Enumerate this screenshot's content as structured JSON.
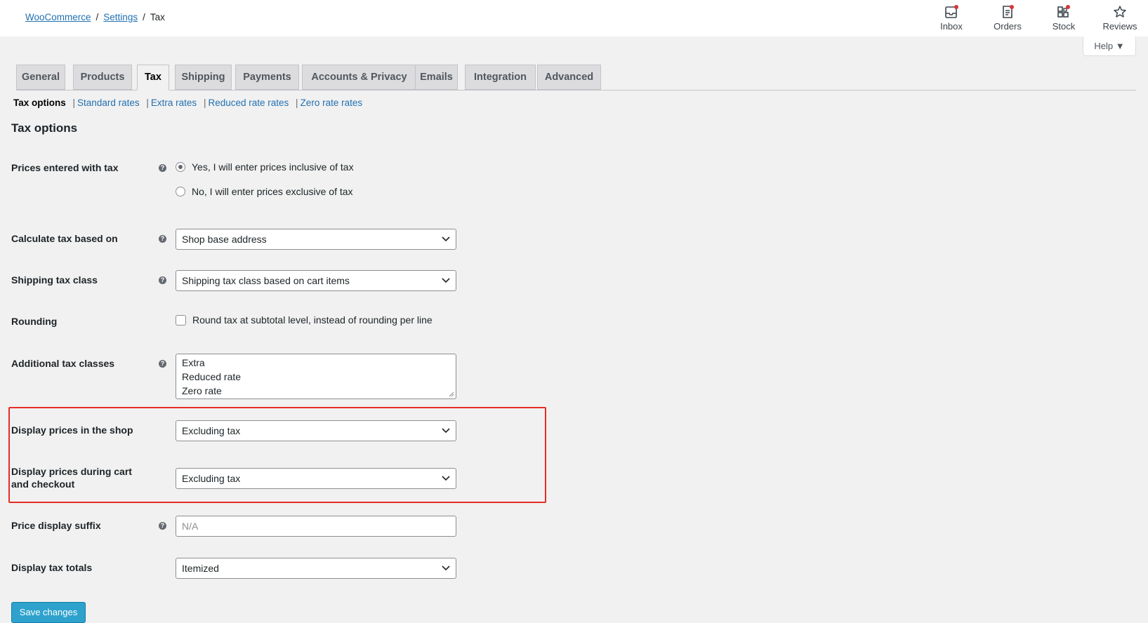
{
  "breadcrumb": {
    "woocommerce": "WooCommerce",
    "settings": "Settings",
    "current": "Tax",
    "separator": "/"
  },
  "activity": {
    "inbox": "Inbox",
    "orders": "Orders",
    "stock": "Stock",
    "reviews": "Reviews",
    "badge_color": "#d63638"
  },
  "help": {
    "label": "Help ▼"
  },
  "tabs": [
    "General",
    "Products",
    "Tax",
    "Shipping",
    "Payments",
    "Accounts & Privacy",
    "Emails",
    "Integration",
    "Advanced"
  ],
  "active_tab": "Tax",
  "subnav": {
    "current": "Tax options",
    "links": [
      "Standard rates",
      "Extra rates",
      "Reduced rate rates",
      "Zero rate rates"
    ],
    "separator": "|"
  },
  "section_title": "Tax options",
  "fields": {
    "prices_entered": {
      "label": "Prices entered with tax",
      "options": [
        "Yes, I will enter prices inclusive of tax",
        "No, I will enter prices exclusive of tax"
      ],
      "selected_index": 0
    },
    "calculate_based_on": {
      "label": "Calculate tax based on",
      "value": "Shop base address"
    },
    "shipping_tax_class": {
      "label": "Shipping tax class",
      "value": "Shipping tax class based on cart items"
    },
    "rounding": {
      "label": "Rounding",
      "checkbox_label": "Round tax at subtotal level, instead of rounding per line",
      "checked": false
    },
    "additional_classes": {
      "label": "Additional tax classes",
      "lines": [
        "Extra",
        "Reduced rate",
        "Zero rate"
      ]
    },
    "display_shop": {
      "label": "Display prices in the shop",
      "value": "Excluding tax"
    },
    "display_cart_line1": "Display prices during cart",
    "display_cart_line2": "and checkout",
    "display_cart": {
      "value": "Excluding tax"
    },
    "price_suffix": {
      "label": "Price display suffix",
      "placeholder": "N/A"
    },
    "tax_totals": {
      "label": "Display tax totals",
      "value": "Itemized"
    }
  },
  "tooltip_glyph": "?",
  "save_button": "Save changes",
  "colors": {
    "accent": "#2271b1",
    "save_button": "#2ea2cc",
    "highlight": "#e52d27"
  }
}
